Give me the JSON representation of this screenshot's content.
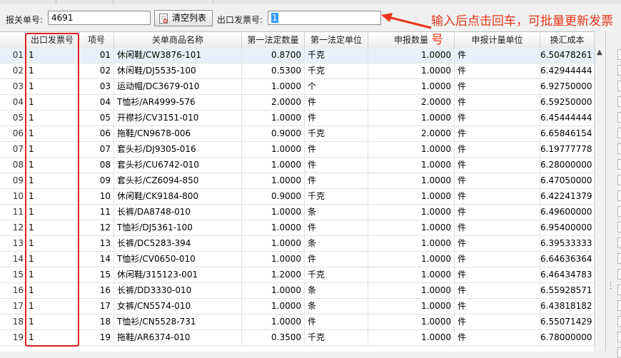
{
  "toolbar": {
    "bg_label": "报关单号:",
    "bg_value": "4691",
    "clear_button": "清空列表",
    "inv_label": "出口发票号:",
    "inv_value": "1"
  },
  "annotation": "输入后点击回车，可批量更新发票号",
  "columns": [
    "出口发票号",
    "项号",
    "关单商品名称",
    "第一法定数量",
    "第一法定单位",
    "申报数量",
    "申报计量单位",
    "换汇成本"
  ],
  "rows": [
    {
      "rn": "01",
      "inv": "1",
      "item": "01",
      "name": "休闲鞋/CW3876-101",
      "qty1": "0.8700",
      "unit1": "千克",
      "dqty": "1.0000",
      "dunit": "件",
      "cost": "6.50478261"
    },
    {
      "rn": "02",
      "inv": "1",
      "item": "02",
      "name": "休闲鞋/DJ5535-100",
      "qty1": "0.5300",
      "unit1": "千克",
      "dqty": "1.0000",
      "dunit": "件",
      "cost": "6.42944444"
    },
    {
      "rn": "03",
      "inv": "1",
      "item": "03",
      "name": "运动帽/DC3679-010",
      "qty1": "1.0000",
      "unit1": "个",
      "dqty": "1.0000",
      "dunit": "件",
      "cost": "6.92750000"
    },
    {
      "rn": "04",
      "inv": "1",
      "item": "04",
      "name": "T恤衫/AR4999-576",
      "qty1": "2.0000",
      "unit1": "件",
      "dqty": "2.0000",
      "dunit": "件",
      "cost": "6.59250000"
    },
    {
      "rn": "05",
      "inv": "1",
      "item": "05",
      "name": "开襟衫/CV3151-010",
      "qty1": "1.0000",
      "unit1": "件",
      "dqty": "1.0000",
      "dunit": "件",
      "cost": "6.45444444"
    },
    {
      "rn": "06",
      "inv": "1",
      "item": "06",
      "name": "拖鞋/CN9678-006",
      "qty1": "0.9000",
      "unit1": "千克",
      "dqty": "2.0000",
      "dunit": "件",
      "cost": "6.65846154"
    },
    {
      "rn": "07",
      "inv": "1",
      "item": "07",
      "name": "套头衫/DJ9305-016",
      "qty1": "1.0000",
      "unit1": "件",
      "dqty": "1.0000",
      "dunit": "件",
      "cost": "6.19777778"
    },
    {
      "rn": "08",
      "inv": "1",
      "item": "08",
      "name": "套头衫/CU6742-010",
      "qty1": "1.0000",
      "unit1": "件",
      "dqty": "1.0000",
      "dunit": "件",
      "cost": "6.28000000"
    },
    {
      "rn": "09",
      "inv": "1",
      "item": "09",
      "name": "套头衫/CZ6094-850",
      "qty1": "1.0000",
      "unit1": "件",
      "dqty": "1.0000",
      "dunit": "件",
      "cost": "6.47050000"
    },
    {
      "rn": "10",
      "inv": "1",
      "item": "10",
      "name": "休闲鞋/CK9184-800",
      "qty1": "0.9000",
      "unit1": "千克",
      "dqty": "1.0000",
      "dunit": "件",
      "cost": "6.42241379"
    },
    {
      "rn": "11",
      "inv": "1",
      "item": "11",
      "name": "长裤/DA8748-010",
      "qty1": "1.0000",
      "unit1": "条",
      "dqty": "1.0000",
      "dunit": "件",
      "cost": "6.49600000"
    },
    {
      "rn": "12",
      "inv": "1",
      "item": "12",
      "name": "T恤衫/DJ5361-100",
      "qty1": "1.0000",
      "unit1": "件",
      "dqty": "1.0000",
      "dunit": "件",
      "cost": "6.95400000"
    },
    {
      "rn": "13",
      "inv": "1",
      "item": "13",
      "name": "长裤/DC5283-394",
      "qty1": "1.0000",
      "unit1": "条",
      "dqty": "1.0000",
      "dunit": "件",
      "cost": "6.39533333"
    },
    {
      "rn": "14",
      "inv": "1",
      "item": "14",
      "name": "T恤衫/CV0650-010",
      "qty1": "1.0000",
      "unit1": "件",
      "dqty": "1.0000",
      "dunit": "件",
      "cost": "6.64636364"
    },
    {
      "rn": "15",
      "inv": "1",
      "item": "15",
      "name": "休闲鞋/315123-001",
      "qty1": "1.2000",
      "unit1": "千克",
      "dqty": "1.0000",
      "dunit": "件",
      "cost": "6.46434783"
    },
    {
      "rn": "16",
      "inv": "1",
      "item": "16",
      "name": "长裤/DD3330-010",
      "qty1": "1.0000",
      "unit1": "条",
      "dqty": "1.0000",
      "dunit": "件",
      "cost": "6.55928571"
    },
    {
      "rn": "17",
      "inv": "1",
      "item": "17",
      "name": "女裤/CN5574-010",
      "qty1": "1.0000",
      "unit1": "条",
      "dqty": "1.0000",
      "dunit": "件",
      "cost": "6.43818182"
    },
    {
      "rn": "18",
      "inv": "1",
      "item": "18",
      "name": "T恤衫/CN5528-731",
      "qty1": "1.0000",
      "unit1": "件",
      "dqty": "1.0000",
      "dunit": "件",
      "cost": "6.55071429"
    },
    {
      "rn": "19",
      "inv": "1",
      "item": "19",
      "name": "拖鞋/AR6374-010",
      "qty1": "0.3500",
      "unit1": "千克",
      "dqty": "1.0000",
      "dunit": "件",
      "cost": "6.78000000"
    }
  ],
  "colors": {
    "annotation": "#e8371c",
    "highlight_box": "#e02020",
    "selected_row": "#e8f1fb"
  },
  "icons": [
    "clear-list-icon",
    "arrow-icon",
    "scroll-up-icon",
    "grip-icon"
  ]
}
